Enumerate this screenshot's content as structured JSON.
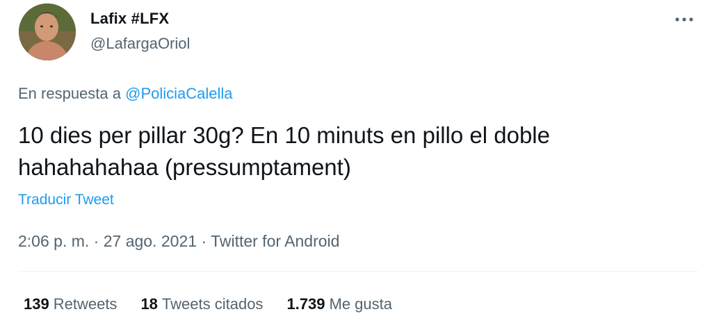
{
  "author": {
    "display_name": "Lafix #LFX",
    "handle": "@LafargaOriol",
    "avatar_icon": "profile-photo"
  },
  "more_icon": "ellipsis-icon",
  "reply": {
    "prefix": "En respuesta a",
    "mention": "@PoliciaCalella"
  },
  "tweet": {
    "line1": "10 dies per pillar 30g? En 10 minuts en pillo el doble",
    "line2": "hahahahahaa (pressumptament)"
  },
  "translate_label": "Traducir Tweet",
  "meta": {
    "time": "2:06 p. m.",
    "sep1": " · ",
    "date": "27 ago. 2021",
    "sep2": " · ",
    "source": "Twitter for Android"
  },
  "stats": [
    {
      "count": "139",
      "label": "Retweets"
    },
    {
      "count": "18",
      "label": "Tweets citados"
    },
    {
      "count": "1.739",
      "label": "Me gusta"
    }
  ],
  "colors": {
    "text": "#0f1419",
    "secondary": "#536471",
    "link": "#1d9bf0"
  }
}
